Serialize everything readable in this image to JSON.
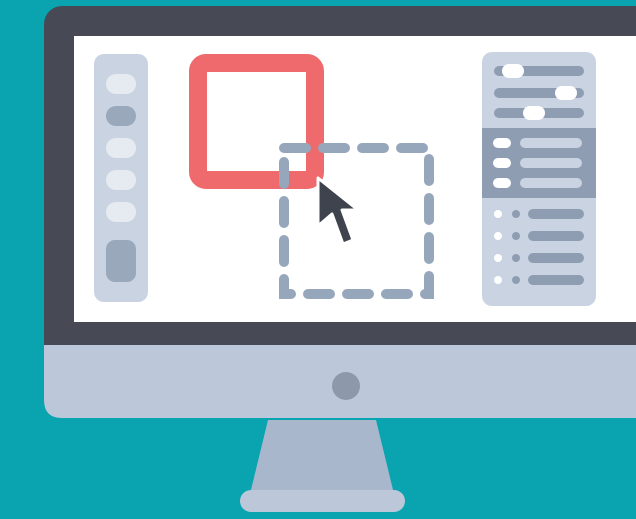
{
  "scene": {
    "subject": "desktop-monitor-illustration",
    "icons": [
      "monitor-icon",
      "mouse-cursor-icon",
      "selection-box-icon",
      "power-button-icon"
    ]
  },
  "colors": {
    "background": "#0aa3b0",
    "bezel": "#474a54",
    "screen": "#ffffff",
    "chin": "#bcc8da",
    "stand": "#a9b7cc",
    "panel": "#c9d3e2",
    "panel_dark": "#8f9db2",
    "accent_red": "#ee6a6d",
    "dashed": "#97a7bb",
    "cursor": "#3f434d"
  },
  "left_toolbar": {
    "tool_count": 6,
    "selected_tool_index": 1
  },
  "right_panel": {
    "top_sliders": [
      0.18,
      0.78,
      0.52
    ],
    "highlighted_rows": 3,
    "list_rows": 4
  }
}
